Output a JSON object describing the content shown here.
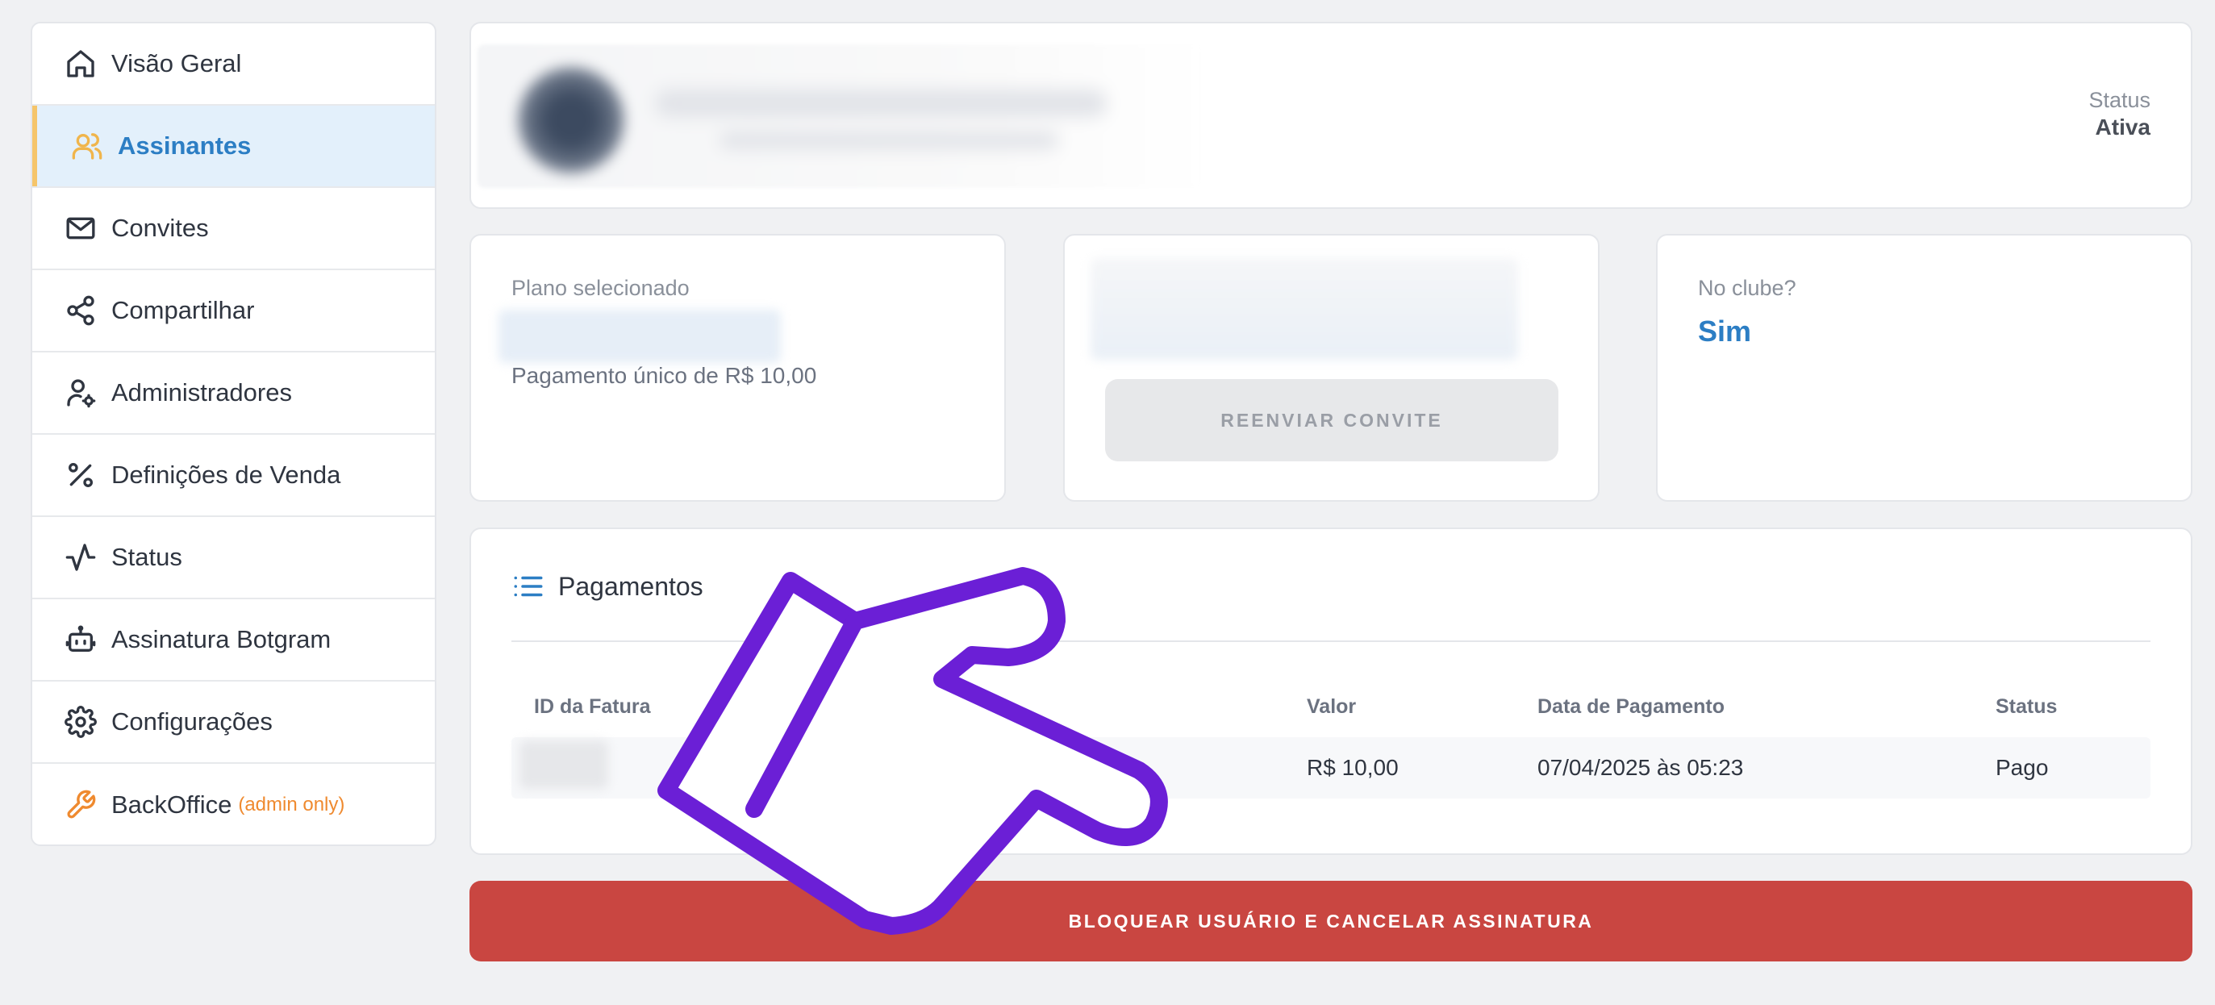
{
  "sidebar": {
    "items": [
      {
        "label": "Visão Geral",
        "icon": "home-icon"
      },
      {
        "label": "Assinantes",
        "icon": "users-icon",
        "active": true
      },
      {
        "label": "Convites",
        "icon": "mail-icon"
      },
      {
        "label": "Compartilhar",
        "icon": "share-icon"
      },
      {
        "label": "Administradores",
        "icon": "user-cog-icon"
      },
      {
        "label": "Definições de Venda",
        "icon": "percent-icon"
      },
      {
        "label": "Status",
        "icon": "activity-icon"
      },
      {
        "label": "Assinatura Botgram",
        "icon": "bot-icon"
      },
      {
        "label": "Configurações",
        "icon": "gear-icon"
      },
      {
        "label": "BackOffice",
        "icon": "wrench-icon",
        "badge": "(admin only)"
      }
    ]
  },
  "header": {
    "status_label": "Status",
    "status_value": "Ativa"
  },
  "plan": {
    "label": "Plano selecionado",
    "description": "Pagamento único de R$ 10,00"
  },
  "invite": {
    "resend_label": "REENVIAR CONVITE"
  },
  "club": {
    "label": "No clube?",
    "value": "Sim"
  },
  "payments": {
    "title": "Pagamentos",
    "columns": [
      "ID da Fatura",
      "Valor",
      "Data de Pagamento",
      "Status"
    ],
    "rows": [
      {
        "value": "R$ 10,00",
        "date": "07/04/2025 às 05:23",
        "status": "Pago"
      }
    ]
  },
  "block_button": "BLOQUEAR USUÁRIO E CANCELAR ASSINATURA",
  "colors": {
    "accent": "#2c7ec4",
    "active_bar": "#f5c56a",
    "danger": "#c94641",
    "pointer": "#6b1fd6",
    "admin_badge": "#ef8a2f"
  }
}
